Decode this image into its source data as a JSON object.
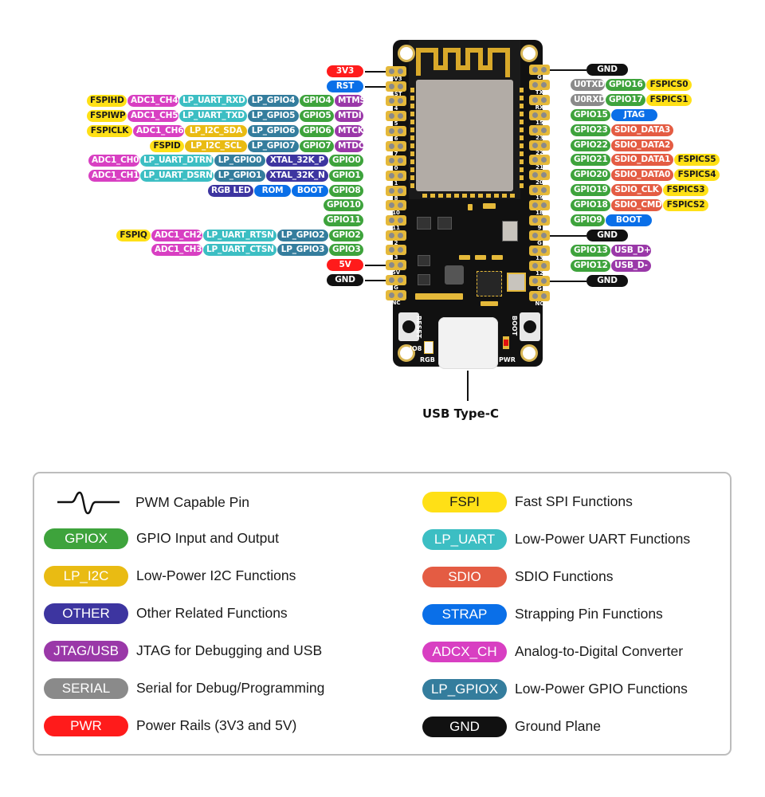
{
  "colors": {
    "PWR": "#ff1b1b",
    "STRAP": "#0a6fe8",
    "GPIO": "#3ea33c",
    "LP_GPIO": "#347d9d",
    "LP_UART": "#3cbec3",
    "LP_I2C": "#e9bb13",
    "FSPI": "#ffe016",
    "ADC": "#d83fc2",
    "JTAG_USB": "#9a38a8",
    "OTHER": "#3d35a0",
    "SERIAL": "#8a8a8a",
    "SDIO": "#e45c43",
    "GND": "#111111"
  },
  "left_pins": [
    {
      "silk": "3V3",
      "pwm": false,
      "labels": [
        {
          "text": "3V3",
          "type": "PWR"
        }
      ]
    },
    {
      "silk": "RST",
      "pwm": false,
      "labels": [
        {
          "text": "RST",
          "type": "STRAP"
        }
      ]
    },
    {
      "silk": "4",
      "pwm": true,
      "labels": [
        {
          "text": "MTMS",
          "type": "JTAG_USB"
        },
        {
          "text": "GPIO4",
          "type": "GPIO"
        },
        {
          "text": "LP_GPIO4",
          "type": "LP_GPIO"
        },
        {
          "text": "LP_UART_RXD",
          "type": "LP_UART"
        },
        {
          "text": "ADC1_CH4",
          "type": "ADC"
        },
        {
          "text": "FSPIHD",
          "type": "FSPI"
        }
      ]
    },
    {
      "silk": "5",
      "pwm": true,
      "labels": [
        {
          "text": "MTDI",
          "type": "JTAG_USB"
        },
        {
          "text": "GPIO5",
          "type": "GPIO"
        },
        {
          "text": "LP_GPIO5",
          "type": "LP_GPIO"
        },
        {
          "text": "LP_UART_TXD",
          "type": "LP_UART"
        },
        {
          "text": "ADC1_CH5",
          "type": "ADC"
        },
        {
          "text": "FSPIWP",
          "type": "FSPI"
        }
      ]
    },
    {
      "silk": "6",
      "pwm": true,
      "labels": [
        {
          "text": "MTCK",
          "type": "JTAG_USB"
        },
        {
          "text": "GPIO6",
          "type": "GPIO"
        },
        {
          "text": "LP_GPIO6",
          "type": "LP_GPIO"
        },
        {
          "text": "LP_I2C_SDA",
          "type": "LP_I2C"
        },
        {
          "text": "ADC1_CH6",
          "type": "ADC"
        },
        {
          "text": "FSPICLK",
          "type": "FSPI"
        }
      ]
    },
    {
      "silk": "7",
      "pwm": true,
      "labels": [
        {
          "text": "MTDO",
          "type": "JTAG_USB"
        },
        {
          "text": "GPIO7",
          "type": "GPIO"
        },
        {
          "text": "LP_GPIO7",
          "type": "LP_GPIO"
        },
        {
          "text": "LP_I2C_SCL",
          "type": "LP_I2C"
        },
        {
          "text": "FSPID",
          "type": "FSPI"
        }
      ]
    },
    {
      "silk": "0",
      "pwm": true,
      "labels": [
        {
          "text": "GPIO0",
          "type": "GPIO"
        },
        {
          "text": "XTAL_32K_P",
          "type": "OTHER"
        },
        {
          "text": "LP_GPIO0",
          "type": "LP_GPIO"
        },
        {
          "text": "LP_UART_DTRN",
          "type": "LP_UART"
        },
        {
          "text": "ADC1_CH0",
          "type": "ADC"
        }
      ]
    },
    {
      "silk": "1",
      "pwm": true,
      "labels": [
        {
          "text": "GPIO1",
          "type": "GPIO"
        },
        {
          "text": "XTAL_32K_N",
          "type": "OTHER"
        },
        {
          "text": "LP_GPIO1",
          "type": "LP_GPIO"
        },
        {
          "text": "LP_UART_DSRN",
          "type": "LP_UART"
        },
        {
          "text": "ADC1_CH1",
          "type": "ADC"
        }
      ]
    },
    {
      "silk": "8",
      "pwm": true,
      "labels": [
        {
          "text": "GPIO8",
          "type": "GPIO"
        },
        {
          "text": "BOOT",
          "type": "STRAP"
        },
        {
          "text": "ROM",
          "type": "STRAP"
        },
        {
          "text": "RGB LED",
          "type": "OTHER"
        }
      ]
    },
    {
      "silk": "10",
      "pwm": true,
      "labels": [
        {
          "text": "GPIO10",
          "type": "GPIO"
        }
      ]
    },
    {
      "silk": "11",
      "pwm": true,
      "labels": [
        {
          "text": "GPIO11",
          "type": "GPIO"
        }
      ]
    },
    {
      "silk": "2",
      "pwm": true,
      "labels": [
        {
          "text": "GPIO2",
          "type": "GPIO"
        },
        {
          "text": "LP_GPIO2",
          "type": "LP_GPIO"
        },
        {
          "text": "LP_UART_RTSN",
          "type": "LP_UART"
        },
        {
          "text": "ADC1_CH2",
          "type": "ADC"
        },
        {
          "text": "FSPIQ",
          "type": "FSPI"
        }
      ]
    },
    {
      "silk": "3",
      "pwm": true,
      "labels": [
        {
          "text": "GPIO3",
          "type": "GPIO"
        },
        {
          "text": "LP_GPIO3",
          "type": "LP_GPIO"
        },
        {
          "text": "LP_UART_CTSN",
          "type": "LP_UART"
        },
        {
          "text": "ADC1_CH3",
          "type": "ADC"
        }
      ]
    },
    {
      "silk": "5V",
      "pwm": false,
      "labels": [
        {
          "text": "5V",
          "type": "PWR"
        }
      ]
    },
    {
      "silk": "G",
      "pwm": false,
      "labels": [
        {
          "text": "GND",
          "type": "GND"
        }
      ]
    },
    {
      "silk": "NC",
      "pwm": false,
      "labels": []
    }
  ],
  "right_pins": [
    {
      "silk": "G",
      "pwm": false,
      "labels": [
        {
          "text": "GND",
          "type": "GND"
        }
      ]
    },
    {
      "silk": "TX",
      "pwm": true,
      "labels": [
        {
          "text": "U0TXD",
          "type": "SERIAL"
        },
        {
          "text": "GPIO16",
          "type": "GPIO"
        },
        {
          "text": "FSPICS0",
          "type": "FSPI"
        }
      ]
    },
    {
      "silk": "RX",
      "pwm": true,
      "labels": [
        {
          "text": "U0RXD",
          "type": "SERIAL"
        },
        {
          "text": "GPIO17",
          "type": "GPIO"
        },
        {
          "text": "FSPICS1",
          "type": "FSPI"
        }
      ]
    },
    {
      "silk": "15",
      "pwm": true,
      "labels": [
        {
          "text": "GPIO15",
          "type": "GPIO"
        },
        {
          "text": "JTAG",
          "type": "STRAP"
        }
      ]
    },
    {
      "silk": "23",
      "pwm": true,
      "labels": [
        {
          "text": "GPIO23",
          "type": "GPIO"
        },
        {
          "text": "SDIO_DATA3",
          "type": "SDIO"
        }
      ]
    },
    {
      "silk": "22",
      "pwm": true,
      "labels": [
        {
          "text": "GPIO22",
          "type": "GPIO"
        },
        {
          "text": "SDIO_DATA2",
          "type": "SDIO"
        }
      ]
    },
    {
      "silk": "21",
      "pwm": true,
      "labels": [
        {
          "text": "GPIO21",
          "type": "GPIO"
        },
        {
          "text": "SDIO_DATA1",
          "type": "SDIO"
        },
        {
          "text": "FSPICS5",
          "type": "FSPI"
        }
      ]
    },
    {
      "silk": "20",
      "pwm": true,
      "labels": [
        {
          "text": "GPIO20",
          "type": "GPIO"
        },
        {
          "text": "SDIO_DATA0",
          "type": "SDIO"
        },
        {
          "text": "FSPICS4",
          "type": "FSPI"
        }
      ]
    },
    {
      "silk": "19",
      "pwm": true,
      "labels": [
        {
          "text": "GPIO19",
          "type": "GPIO"
        },
        {
          "text": "SDIO_CLK",
          "type": "SDIO"
        },
        {
          "text": "FSPICS3",
          "type": "FSPI"
        }
      ]
    },
    {
      "silk": "18",
      "pwm": true,
      "labels": [
        {
          "text": "GPIO18",
          "type": "GPIO"
        },
        {
          "text": "SDIO_CMD",
          "type": "SDIO"
        },
        {
          "text": "FSPICS2",
          "type": "FSPI"
        }
      ]
    },
    {
      "silk": "9",
      "pwm": true,
      "labels": [
        {
          "text": "GPIO9",
          "type": "GPIO"
        },
        {
          "text": "BOOT",
          "type": "STRAP"
        }
      ]
    },
    {
      "silk": "G",
      "pwm": false,
      "labels": [
        {
          "text": "GND",
          "type": "GND"
        }
      ]
    },
    {
      "silk": "13",
      "pwm": true,
      "labels": [
        {
          "text": "GPIO13",
          "type": "GPIO"
        },
        {
          "text": "USB_D+",
          "type": "JTAG_USB"
        }
      ]
    },
    {
      "silk": "12",
      "pwm": true,
      "labels": [
        {
          "text": "GPIO12",
          "type": "GPIO"
        },
        {
          "text": "USB_D-",
          "type": "JTAG_USB"
        }
      ]
    },
    {
      "silk": "G",
      "pwm": false,
      "labels": [
        {
          "text": "GND",
          "type": "GND"
        }
      ]
    },
    {
      "silk": "NC",
      "pwm": false,
      "labels": []
    }
  ],
  "board": {
    "reset_label": "RESET",
    "boot_label": "BOOT",
    "io8_label": "IO8",
    "rgb_label": "RGB",
    "pwr_label": "PWR",
    "usb_caption": "USB Type-C"
  },
  "legend": {
    "pwm": {
      "text": "PWM Capable Pin"
    },
    "left": [
      {
        "badge": "GPIOX",
        "type": "GPIO",
        "text": "GPIO Input and Output"
      },
      {
        "badge": "LP_I2C",
        "type": "LP_I2C",
        "text": "Low-Power I2C Functions"
      },
      {
        "badge": "OTHER",
        "type": "OTHER",
        "text": "Other Related Functions"
      },
      {
        "badge": "JTAG/USB",
        "type": "JTAG_USB",
        "text": "JTAG for Debugging and USB"
      },
      {
        "badge": "SERIAL",
        "type": "SERIAL",
        "text": "Serial for Debug/Programming"
      },
      {
        "badge": "PWR",
        "type": "PWR",
        "text": "Power Rails (3V3 and 5V)"
      }
    ],
    "right": [
      {
        "badge": "FSPI",
        "type": "FSPI",
        "text": "Fast SPI Functions"
      },
      {
        "badge": "LP_UART",
        "type": "LP_UART",
        "text": "Low-Power UART Functions"
      },
      {
        "badge": "SDIO",
        "type": "SDIO",
        "text": "SDIO Functions"
      },
      {
        "badge": "STRAP",
        "type": "STRAP",
        "text": "Strapping Pin Functions"
      },
      {
        "badge": "ADCX_CH",
        "type": "ADC",
        "text": "Analog-to-Digital Converter"
      },
      {
        "badge": "LP_GPIOX",
        "type": "LP_GPIO",
        "text": "Low-Power GPIO Functions"
      },
      {
        "badge": "GND",
        "type": "GND",
        "text": "Ground Plane"
      }
    ]
  }
}
